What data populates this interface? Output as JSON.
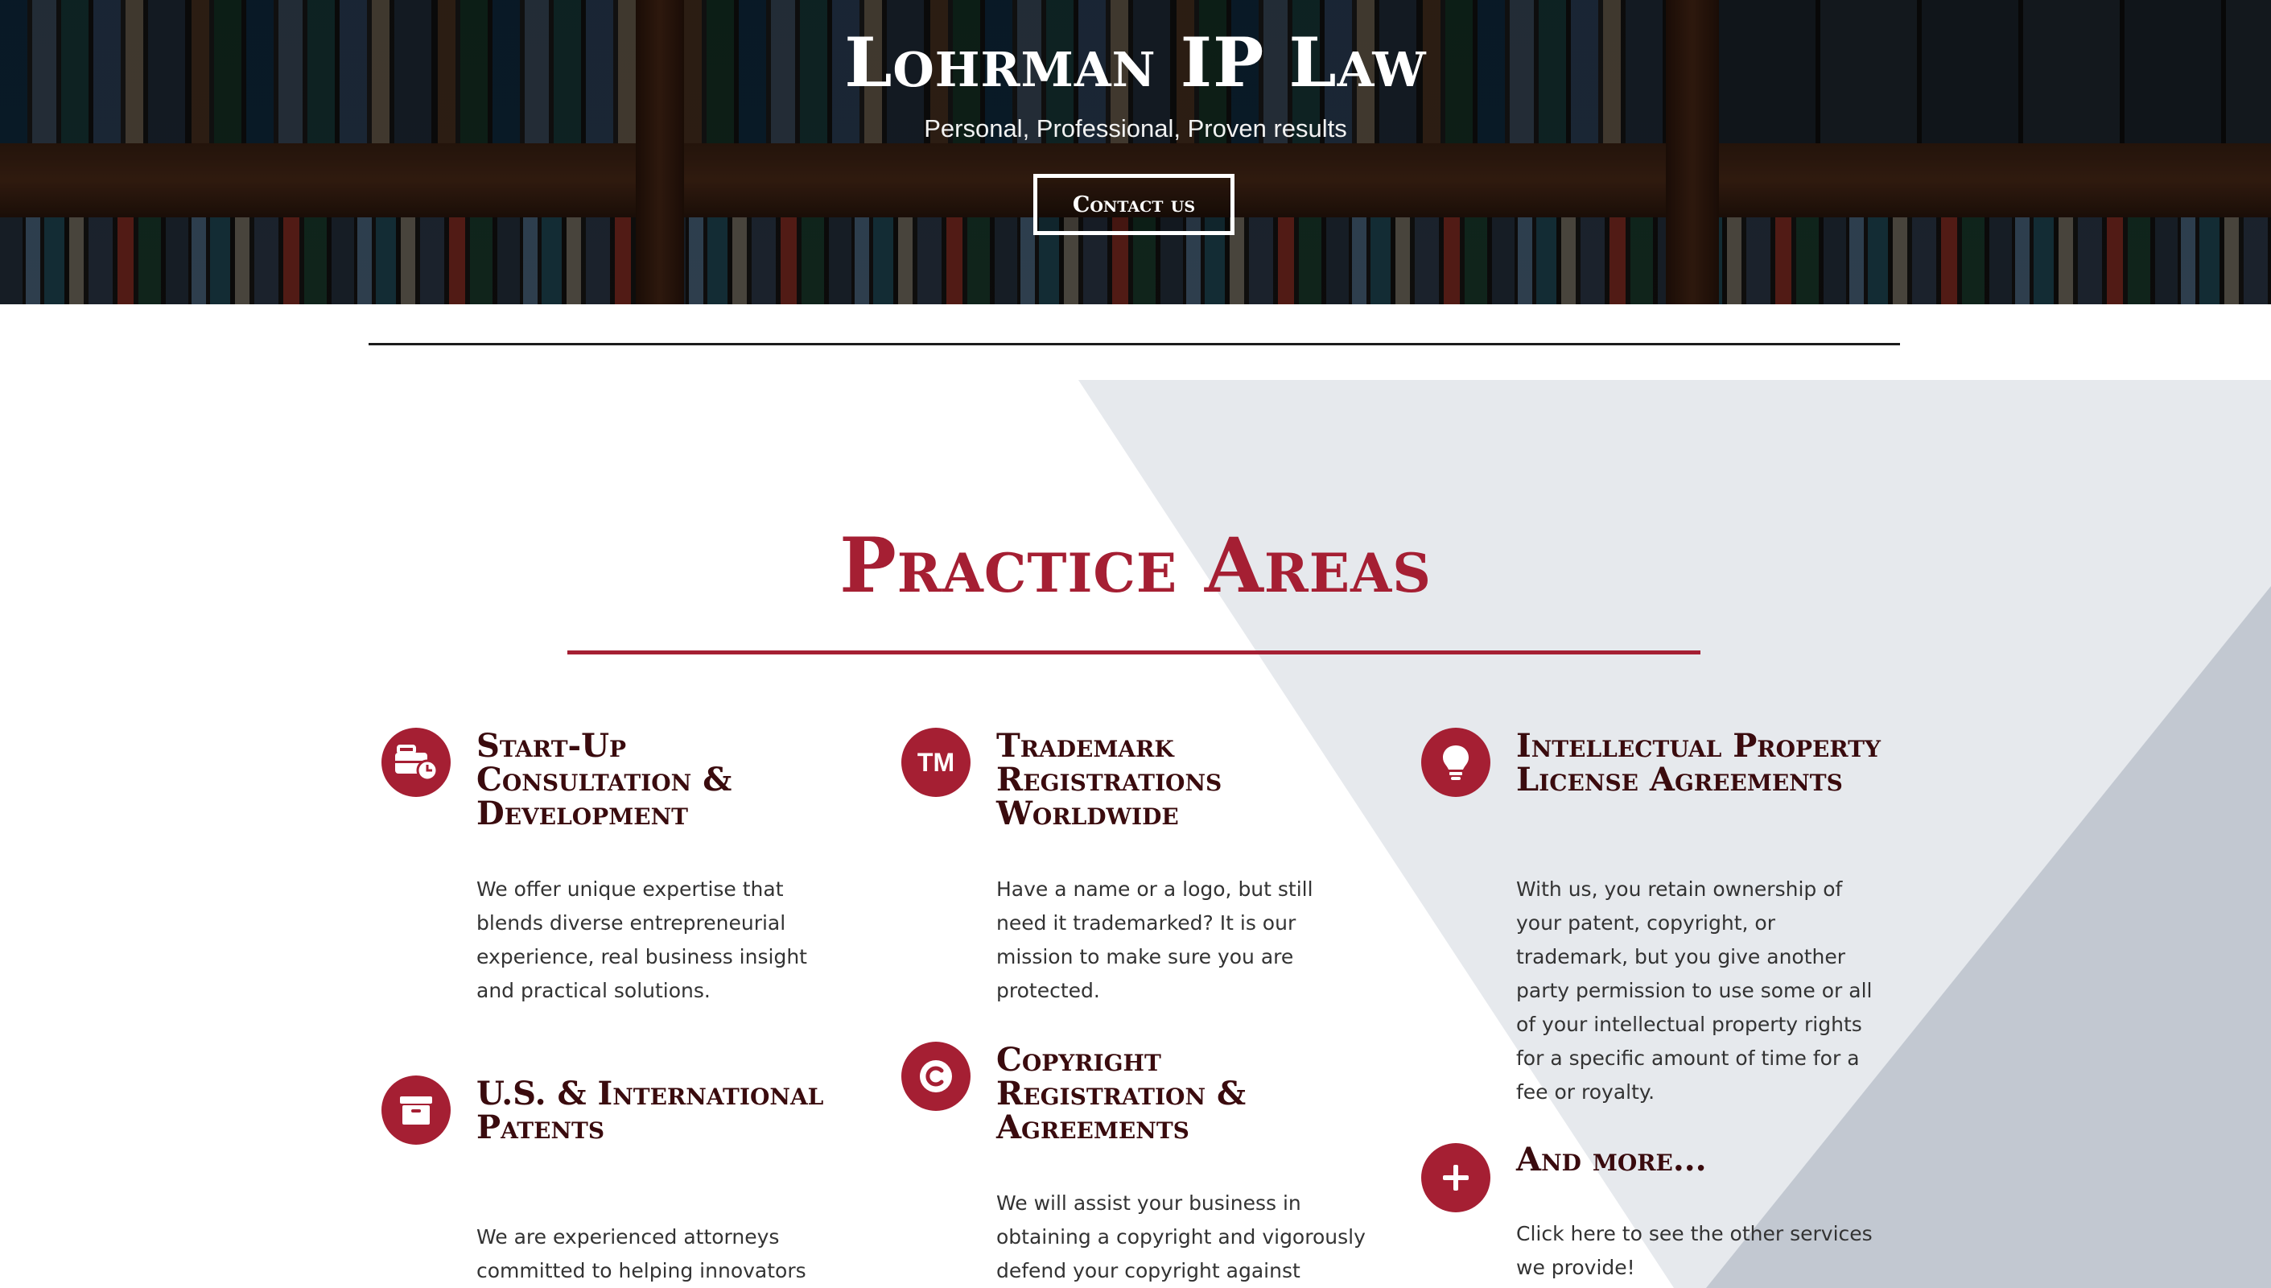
{
  "hero": {
    "title": "Lohrman IP Law",
    "subtitle": "Personal, Professional, Proven results",
    "cta_label": "Contact us"
  },
  "colors": {
    "accent": "#a51f33",
    "title_dark": "#3a0b0e",
    "triangle_light": "#e6e9ed",
    "triangle_dark": "#c2c8d1"
  },
  "practice": {
    "heading": "Practice Areas",
    "items": [
      {
        "icon": "briefcase-clock-icon",
        "title": "Start-Up Consultation & Development",
        "desc": "We offer unique expertise that blends diverse entrepreneurial experience, real business insight and practical solutions."
      },
      {
        "icon": "trademark-icon",
        "title": "Trademark Registrations Worldwide",
        "desc": "Have a name or a logo, but still need it trademarked? It is our mission to make sure you are protected."
      },
      {
        "icon": "lightbulb-icon",
        "title": "Intellectual Property License Agreements",
        "desc": "With us, you retain ownership of your patent, copyright, or trademark, but you give another party permission to use some or all of your intellectual property rights for a specific amount of time for a fee or royalty."
      },
      {
        "icon": "archive-box-icon",
        "title": "U.S. & International Patents",
        "desc": "We are experienced attorneys committed to helping innovators"
      },
      {
        "icon": "copyright-icon",
        "title": "Copyright Registration & Agreements",
        "desc": "We will assist your business in obtaining a copyright and vigorously defend your copyright against"
      },
      {
        "icon": "plus-icon",
        "title": "And more...",
        "desc": "Click here to see the other services we provide!"
      }
    ],
    "tm_glyph": "TM"
  }
}
